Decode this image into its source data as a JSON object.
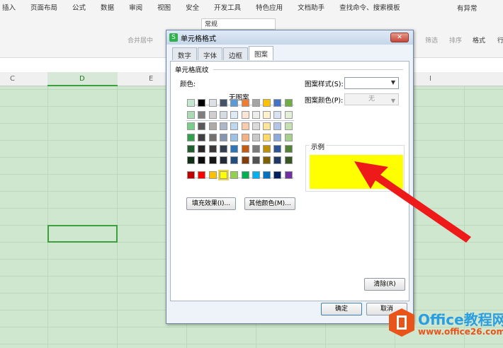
{
  "menu": [
    "插入",
    "页面布局",
    "公式",
    "数据",
    "审阅",
    "视图",
    "安全",
    "开发工具",
    "特色应用",
    "文档助手",
    "查找命令、搜索模板"
  ],
  "account": "有异常",
  "toolbar": {
    "format_value": "常规",
    "merge": "合并居中",
    "filter": "筛选",
    "sort": "排序",
    "format": "格式",
    "row": "行"
  },
  "columns": [
    "C",
    "D",
    "E",
    "I"
  ],
  "dialog": {
    "title": "单元格格式",
    "tabs": [
      "数字",
      "字体",
      "边框",
      "图案"
    ],
    "active_tab": "图案",
    "group": "单元格底纹",
    "color_label": "颜色:",
    "no_pattern": "无图案",
    "pattern_style_label": "图案样式(S):",
    "pattern_color_label": "图案颜色(P):",
    "pattern_color_value": "无",
    "sample_label": "示例",
    "fill_effects": "填充效果(I)...",
    "more_colors": "其他颜色(M)...",
    "clear": "清除(R)",
    "ok": "确定",
    "cancel": "取消",
    "selected_color": "#ffff00"
  },
  "palette": [
    [
      "#c6e7cf",
      "#000000",
      "#dde1e6",
      "#44546a",
      "#5b9bd5",
      "#ed7d31",
      "#a5a5a5",
      "#ffc000",
      "#4472c4",
      "#70ad47"
    ],
    [
      "#a9dcb4",
      "#7f7f7f",
      "#d0cece",
      "#d6dce4",
      "#deebf6",
      "#fbe5d5",
      "#ededed",
      "#fff2cc",
      "#d9e2f3",
      "#e2efd9"
    ],
    [
      "#77cf8b",
      "#595959",
      "#aeaaaa",
      "#adb9ca",
      "#bdd7ee",
      "#f7cbac",
      "#dbdbdb",
      "#fee599",
      "#b4c6e7",
      "#c5e0b3"
    ],
    [
      "#32a04b",
      "#3f3f3f",
      "#757070",
      "#8496b0",
      "#9cc3e5",
      "#f4b183",
      "#c9c9c9",
      "#ffd965",
      "#8eaadb",
      "#a8d08d"
    ],
    [
      "#1e5f2d",
      "#262626",
      "#3a3838",
      "#323f4f",
      "#2e75b5",
      "#c55a11",
      "#7b7b7b",
      "#bf9000",
      "#2f5496",
      "#538135"
    ],
    [
      "#0f2f16",
      "#0c0c0c",
      "#171616",
      "#222a35",
      "#1e4e79",
      "#833c0b",
      "#525252",
      "#7f6000",
      "#1f3864",
      "#375623"
    ],
    [
      "#c00000",
      "#ff0000",
      "#ffc000",
      "#ffff00",
      "#92d050",
      "#00b050",
      "#00b0f0",
      "#0070c0",
      "#002060",
      "#7030a0"
    ]
  ],
  "watermark": {
    "brand": "Office教程网",
    "url": "www.office26.com"
  }
}
